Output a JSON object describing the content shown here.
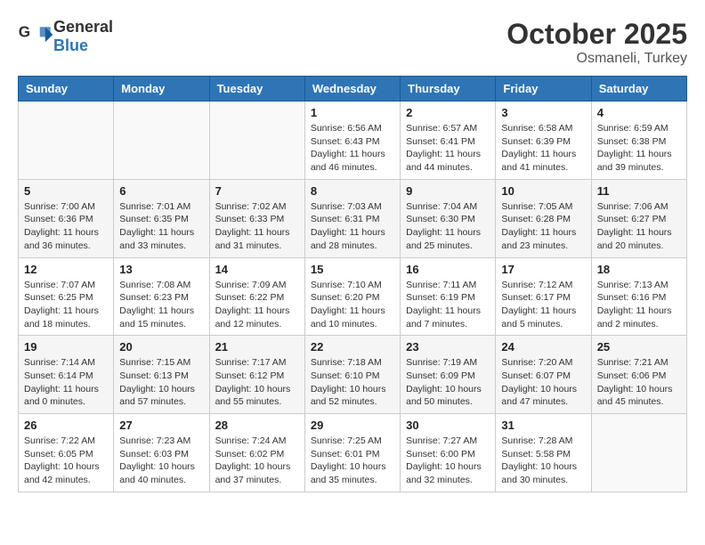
{
  "header": {
    "logo_general": "General",
    "logo_blue": "Blue",
    "month": "October 2025",
    "location": "Osmaneli, Turkey"
  },
  "days_of_week": [
    "Sunday",
    "Monday",
    "Tuesday",
    "Wednesday",
    "Thursday",
    "Friday",
    "Saturday"
  ],
  "weeks": [
    [
      {
        "day": "",
        "info": ""
      },
      {
        "day": "",
        "info": ""
      },
      {
        "day": "",
        "info": ""
      },
      {
        "day": "1",
        "info": "Sunrise: 6:56 AM\nSunset: 6:43 PM\nDaylight: 11 hours\nand 46 minutes."
      },
      {
        "day": "2",
        "info": "Sunrise: 6:57 AM\nSunset: 6:41 PM\nDaylight: 11 hours\nand 44 minutes."
      },
      {
        "day": "3",
        "info": "Sunrise: 6:58 AM\nSunset: 6:39 PM\nDaylight: 11 hours\nand 41 minutes."
      },
      {
        "day": "4",
        "info": "Sunrise: 6:59 AM\nSunset: 6:38 PM\nDaylight: 11 hours\nand 39 minutes."
      }
    ],
    [
      {
        "day": "5",
        "info": "Sunrise: 7:00 AM\nSunset: 6:36 PM\nDaylight: 11 hours\nand 36 minutes."
      },
      {
        "day": "6",
        "info": "Sunrise: 7:01 AM\nSunset: 6:35 PM\nDaylight: 11 hours\nand 33 minutes."
      },
      {
        "day": "7",
        "info": "Sunrise: 7:02 AM\nSunset: 6:33 PM\nDaylight: 11 hours\nand 31 minutes."
      },
      {
        "day": "8",
        "info": "Sunrise: 7:03 AM\nSunset: 6:31 PM\nDaylight: 11 hours\nand 28 minutes."
      },
      {
        "day": "9",
        "info": "Sunrise: 7:04 AM\nSunset: 6:30 PM\nDaylight: 11 hours\nand 25 minutes."
      },
      {
        "day": "10",
        "info": "Sunrise: 7:05 AM\nSunset: 6:28 PM\nDaylight: 11 hours\nand 23 minutes."
      },
      {
        "day": "11",
        "info": "Sunrise: 7:06 AM\nSunset: 6:27 PM\nDaylight: 11 hours\nand 20 minutes."
      }
    ],
    [
      {
        "day": "12",
        "info": "Sunrise: 7:07 AM\nSunset: 6:25 PM\nDaylight: 11 hours\nand 18 minutes."
      },
      {
        "day": "13",
        "info": "Sunrise: 7:08 AM\nSunset: 6:23 PM\nDaylight: 11 hours\nand 15 minutes."
      },
      {
        "day": "14",
        "info": "Sunrise: 7:09 AM\nSunset: 6:22 PM\nDaylight: 11 hours\nand 12 minutes."
      },
      {
        "day": "15",
        "info": "Sunrise: 7:10 AM\nSunset: 6:20 PM\nDaylight: 11 hours\nand 10 minutes."
      },
      {
        "day": "16",
        "info": "Sunrise: 7:11 AM\nSunset: 6:19 PM\nDaylight: 11 hours\nand 7 minutes."
      },
      {
        "day": "17",
        "info": "Sunrise: 7:12 AM\nSunset: 6:17 PM\nDaylight: 11 hours\nand 5 minutes."
      },
      {
        "day": "18",
        "info": "Sunrise: 7:13 AM\nSunset: 6:16 PM\nDaylight: 11 hours\nand 2 minutes."
      }
    ],
    [
      {
        "day": "19",
        "info": "Sunrise: 7:14 AM\nSunset: 6:14 PM\nDaylight: 11 hours\nand 0 minutes."
      },
      {
        "day": "20",
        "info": "Sunrise: 7:15 AM\nSunset: 6:13 PM\nDaylight: 10 hours\nand 57 minutes."
      },
      {
        "day": "21",
        "info": "Sunrise: 7:17 AM\nSunset: 6:12 PM\nDaylight: 10 hours\nand 55 minutes."
      },
      {
        "day": "22",
        "info": "Sunrise: 7:18 AM\nSunset: 6:10 PM\nDaylight: 10 hours\nand 52 minutes."
      },
      {
        "day": "23",
        "info": "Sunrise: 7:19 AM\nSunset: 6:09 PM\nDaylight: 10 hours\nand 50 minutes."
      },
      {
        "day": "24",
        "info": "Sunrise: 7:20 AM\nSunset: 6:07 PM\nDaylight: 10 hours\nand 47 minutes."
      },
      {
        "day": "25",
        "info": "Sunrise: 7:21 AM\nSunset: 6:06 PM\nDaylight: 10 hours\nand 45 minutes."
      }
    ],
    [
      {
        "day": "26",
        "info": "Sunrise: 7:22 AM\nSunset: 6:05 PM\nDaylight: 10 hours\nand 42 minutes."
      },
      {
        "day": "27",
        "info": "Sunrise: 7:23 AM\nSunset: 6:03 PM\nDaylight: 10 hours\nand 40 minutes."
      },
      {
        "day": "28",
        "info": "Sunrise: 7:24 AM\nSunset: 6:02 PM\nDaylight: 10 hours\nand 37 minutes."
      },
      {
        "day": "29",
        "info": "Sunrise: 7:25 AM\nSunset: 6:01 PM\nDaylight: 10 hours\nand 35 minutes."
      },
      {
        "day": "30",
        "info": "Sunrise: 7:27 AM\nSunset: 6:00 PM\nDaylight: 10 hours\nand 32 minutes."
      },
      {
        "day": "31",
        "info": "Sunrise: 7:28 AM\nSunset: 5:58 PM\nDaylight: 10 hours\nand 30 minutes."
      },
      {
        "day": "",
        "info": ""
      }
    ]
  ]
}
